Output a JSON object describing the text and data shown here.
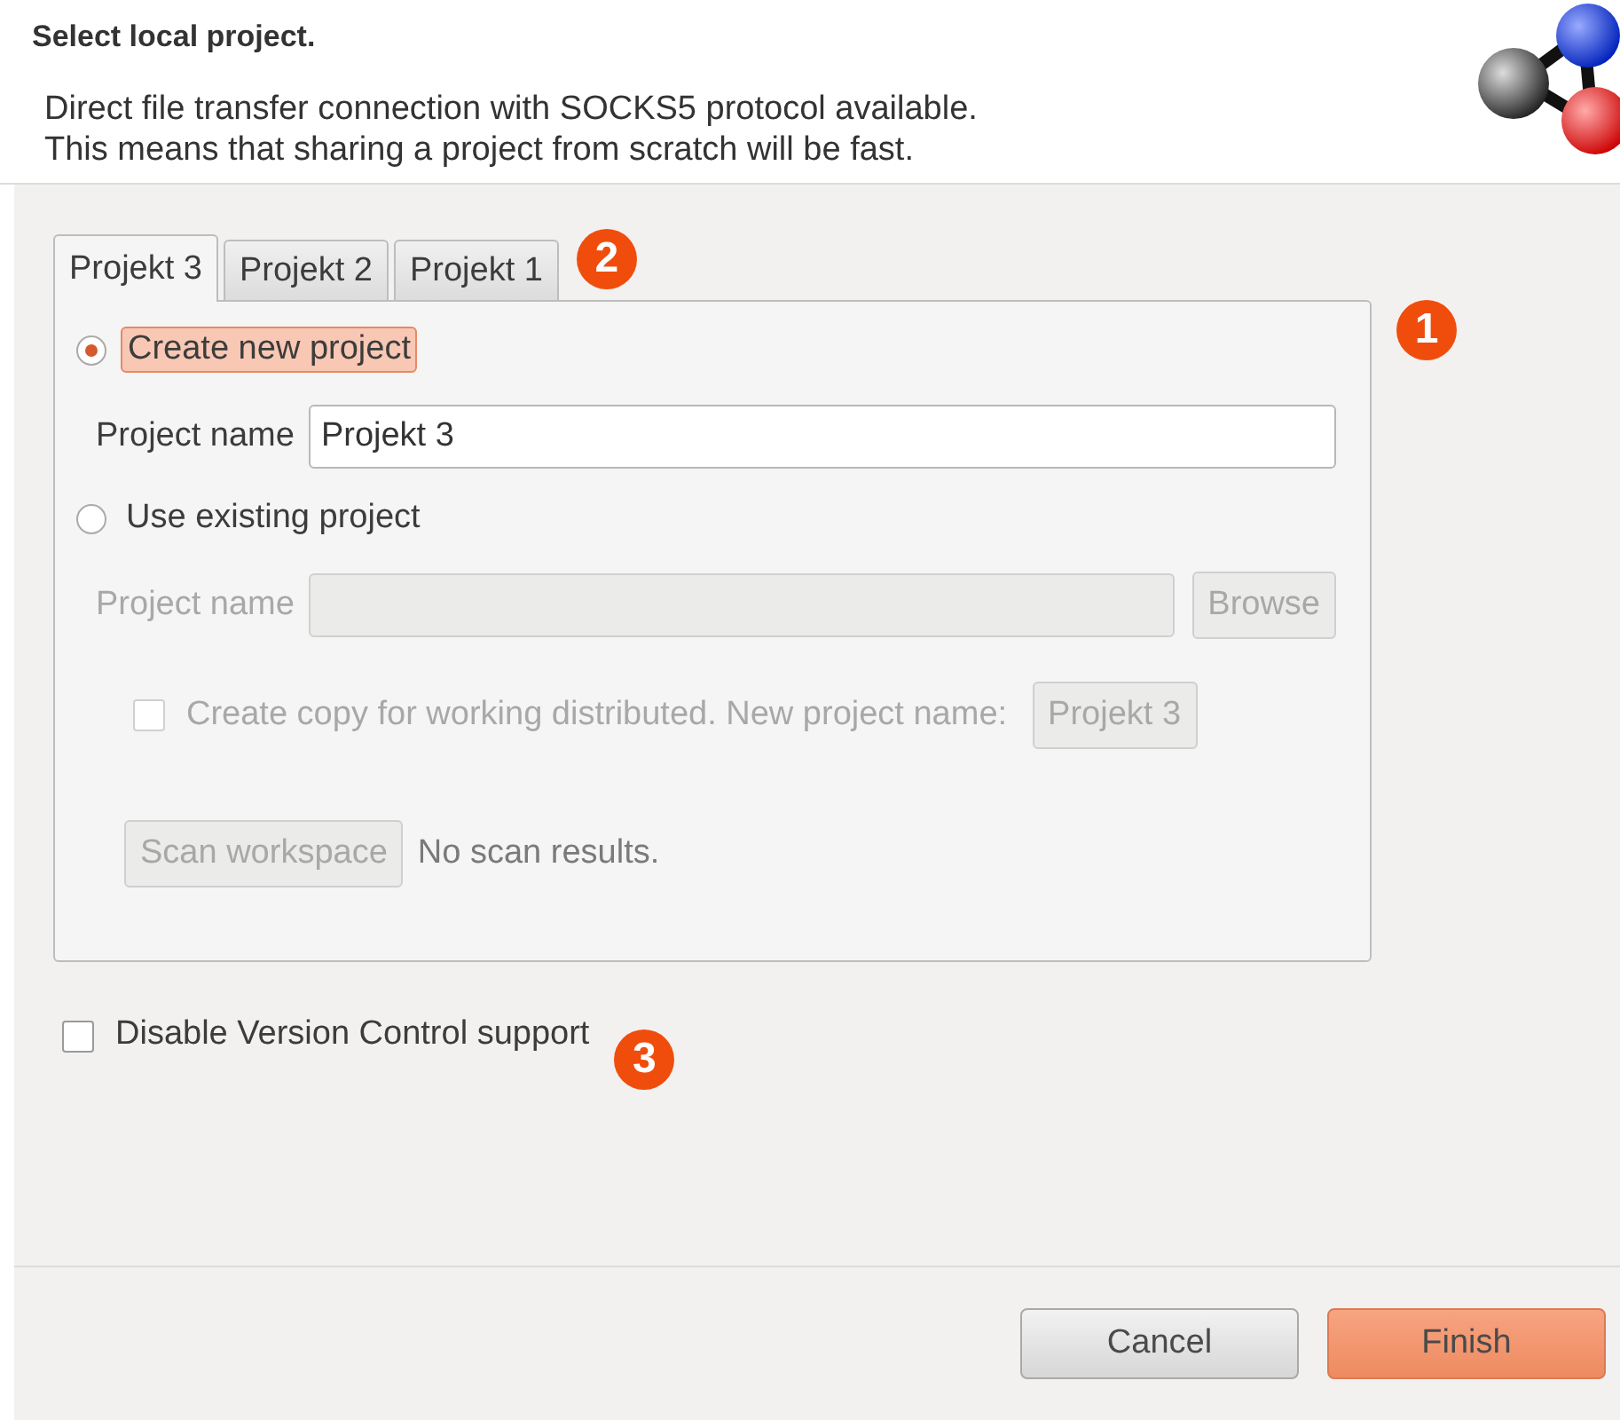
{
  "header": {
    "title": "Select local project.",
    "description": [
      "Direct file transfer connection with SOCKS5 protocol available.",
      "This means that sharing a project from scratch will be fast."
    ]
  },
  "tabs": [
    {
      "label": "Projekt 3",
      "selected": true
    },
    {
      "label": "Projekt 2",
      "selected": false
    },
    {
      "label": "Projekt 1",
      "selected": false
    }
  ],
  "new_project": {
    "label": "Create new project",
    "selected": true,
    "focused": true,
    "name_label": "Project name",
    "name_value": "Projekt 3"
  },
  "existing_project": {
    "label": "Use existing project",
    "selected": false,
    "disabled": true,
    "name_label": "Project name",
    "browse": "Browse",
    "copy_label": "Create copy for working distributed. New project name:",
    "copy_checked": false,
    "copy_name": "Projekt 3",
    "scan": "Scan workspace",
    "scan_status": "No scan results."
  },
  "disable_vcs": {
    "label": "Disable Version Control support",
    "checked": false
  },
  "markers": [
    "1",
    "2",
    "3"
  ],
  "buttons": [
    {
      "label": "Cancel",
      "kind": "default"
    },
    {
      "label": "Finish",
      "kind": "primary"
    }
  ]
}
